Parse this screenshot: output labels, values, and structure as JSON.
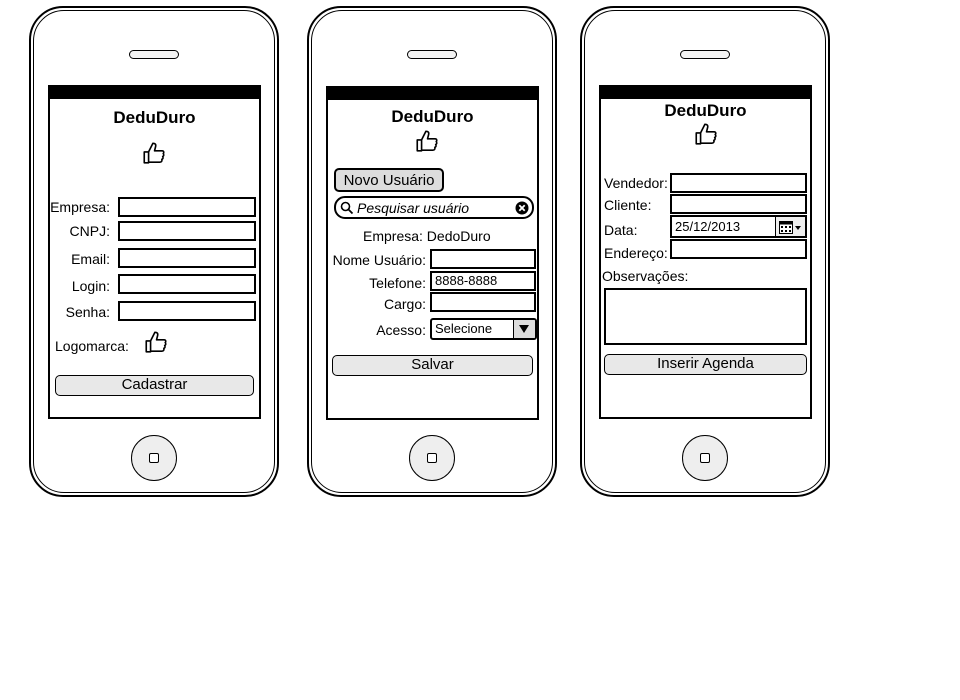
{
  "screen1": {
    "app_title": "DeduDuro",
    "labels": {
      "empresa": "Empresa:",
      "cnpj": "CNPJ:",
      "email": "Email:",
      "login": "Login:",
      "senha": "Senha:",
      "logomarca": "Logomarca:"
    },
    "submit_label": "Cadastrar"
  },
  "screen2": {
    "app_title": "DeduDuro",
    "new_user_label": "Novo Usuário",
    "search_placeholder": "Pesquisar usuário",
    "company_text": "Empresa: DedoDuro",
    "labels": {
      "nome": "Nome Usuário:",
      "telefone": "Telefone:",
      "cargo": "Cargo:",
      "acesso": "Acesso:"
    },
    "telefone_value": "8888-8888",
    "acesso_value": "Selecione",
    "save_label": "Salvar"
  },
  "screen3": {
    "app_title": "DeduDuro",
    "labels": {
      "vendedor": "Vendedor:",
      "cliente": "Cliente:",
      "data": "Data:",
      "endereco": "Endereço:",
      "observacoes": "Observações:"
    },
    "data_value": "25/12/2013",
    "submit_label": "Inserir Agenda"
  },
  "icons": {
    "logo": "thumbs-up-icon",
    "search": "search-icon",
    "clear": "clear-icon",
    "dropdown": "chevron-down-icon",
    "calendar": "calendar-icon"
  }
}
